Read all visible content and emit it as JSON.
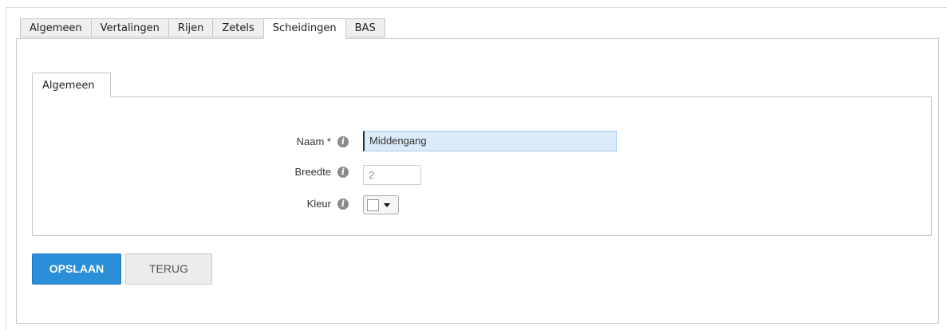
{
  "tabs": [
    {
      "label": "Algemeen",
      "active": false
    },
    {
      "label": "Vertalingen",
      "active": false
    },
    {
      "label": "Rijen",
      "active": false
    },
    {
      "label": "Zetels",
      "active": false
    },
    {
      "label": "Scheidingen",
      "active": true
    },
    {
      "label": "BAS",
      "active": false
    }
  ],
  "subtab": {
    "label": "Algemeen"
  },
  "form": {
    "name_label": "Naam *",
    "name_value": "Middengang",
    "width_label": "Breedte",
    "width_value": "2",
    "color_label": "Kleur",
    "color_value": "#ffffff"
  },
  "buttons": {
    "save": "OPSLAAN",
    "back": "TERUG"
  },
  "icons": {
    "info": "info-icon",
    "dropdown": "caret-down-icon"
  },
  "colors": {
    "accent": "#2b8ed8",
    "name_field_bg": "#dcebf9"
  }
}
